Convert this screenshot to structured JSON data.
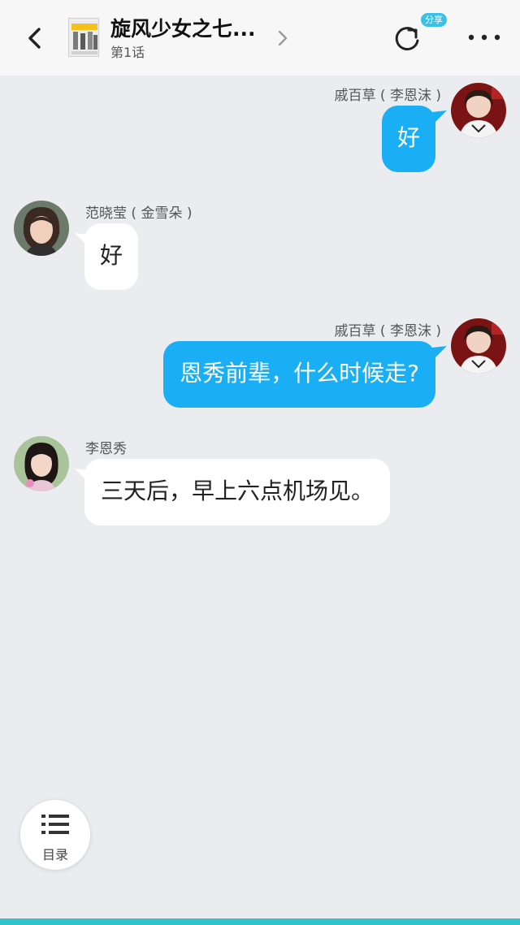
{
  "header": {
    "title": "旋风少女之七...",
    "episode": "第1话",
    "share_badge": "分享"
  },
  "messages": [
    {
      "side": "right",
      "name": "戚百草 ( 李恩沫 )",
      "text": "好"
    },
    {
      "side": "left",
      "name": "范晓莹 ( 金雪朵 )",
      "text": "好"
    },
    {
      "side": "right",
      "name": "戚百草 ( 李恩沫 )",
      "text": "恩秀前辈，什么时候走?"
    },
    {
      "side": "left",
      "name": "李恩秀",
      "text": "三天后，早上六点机场见。"
    }
  ],
  "toc": {
    "label": "目录"
  },
  "colors": {
    "accent_bubble": "#1aaff5",
    "share_badge": "#3bc1e6",
    "bottom_strip": "#2ec4c8",
    "background": "#ebecf0"
  }
}
